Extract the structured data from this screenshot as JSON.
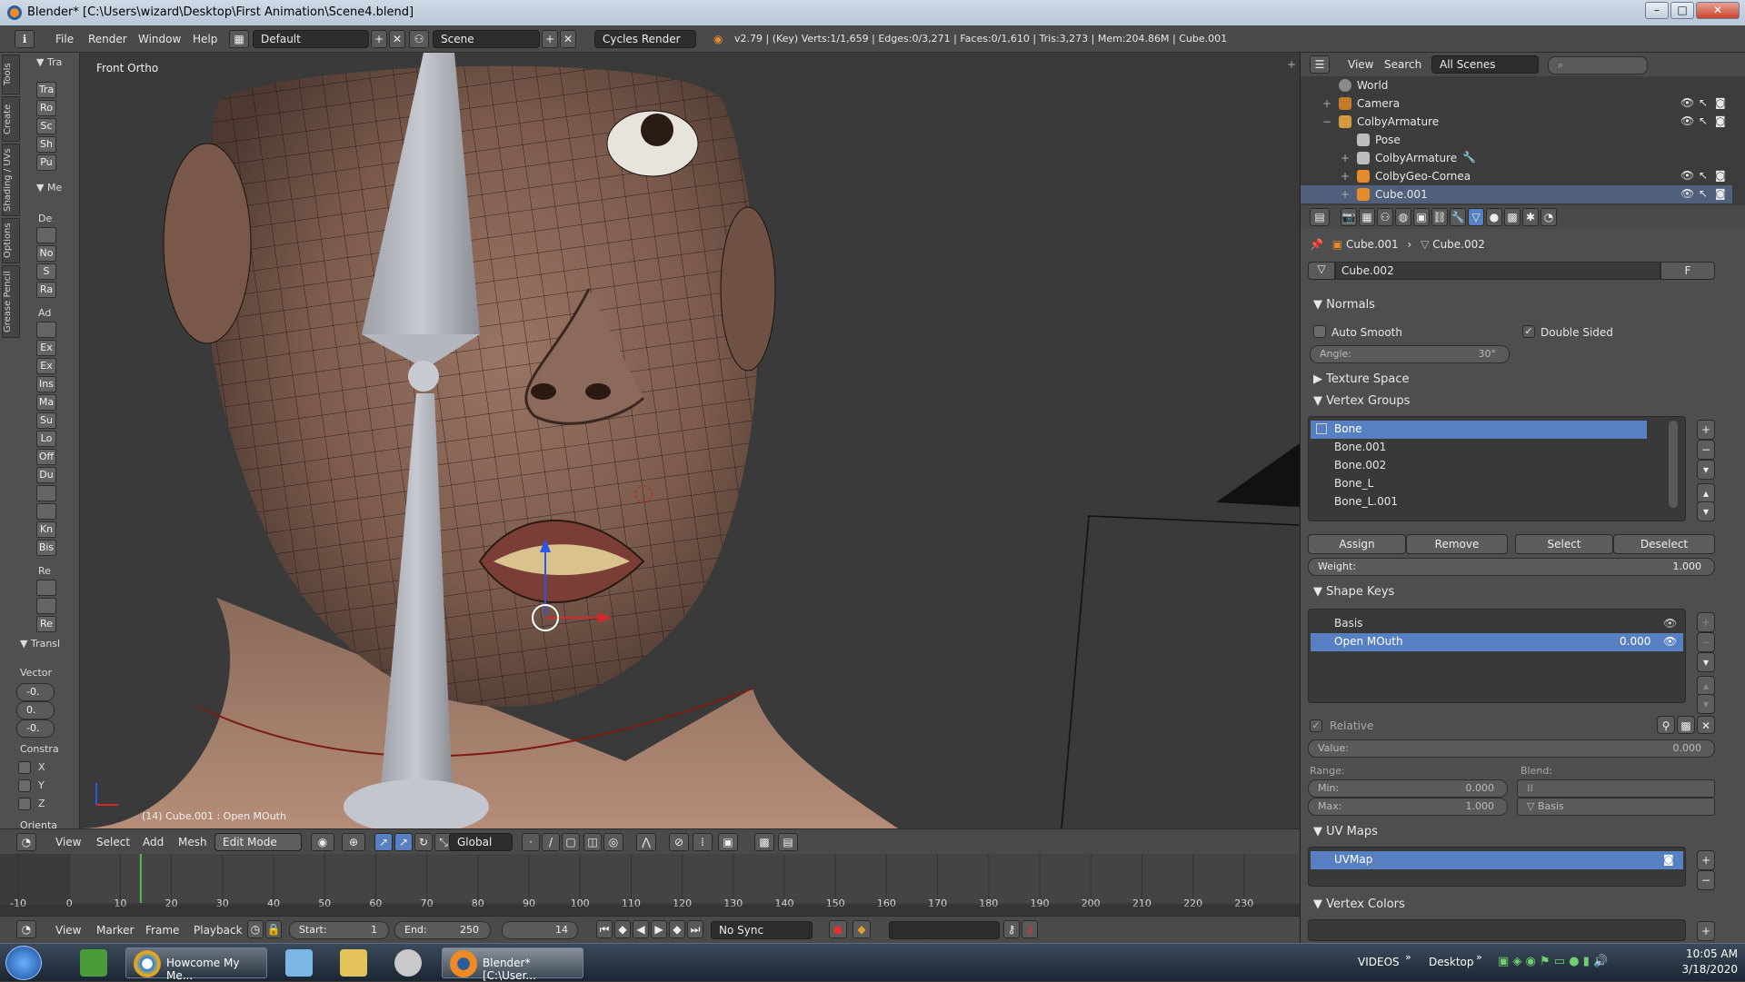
{
  "window": {
    "title": "Blender* [C:\\Users\\wizard\\Desktop\\First Animation\\Scene4.blend]",
    "min": "–",
    "max": "□",
    "close": "✕"
  },
  "menus": [
    "File",
    "Render",
    "Window",
    "Help"
  ],
  "screen_layout": "Default",
  "scene": "Scene",
  "render_engine": "Cycles Render",
  "stats": "v2.79 | (Key) Verts:1/1,659 | Edges:0/3,271 | Faces:0/1,610 | Tris:3,273 | Mem:204.86M | Cube.001",
  "toolshelf": {
    "tabs": [
      "Tools",
      "Create",
      "Shading / UVs",
      "Options",
      "Grease Pencil"
    ],
    "transform_header": "Tra",
    "transform_buttons": [
      "Tra",
      "Ro",
      "Sc",
      "Sh",
      "Pu"
    ],
    "mesh_header": "Me",
    "deform_label": "De",
    "deform_buttons": [
      "",
      "No",
      "S",
      "Ra"
    ],
    "add_label": "Ad",
    "add_buttons": [
      "",
      "Ex",
      "Ex",
      "Ins",
      "Ma",
      "Su",
      "Lo",
      "Off",
      "Du",
      "",
      "",
      "Kn",
      "Bis"
    ],
    "remove_label": "Re",
    "remove_buttons": [
      "",
      "",
      "Re"
    ],
    "translate_header": "Transl",
    "vector_label": "Vector",
    "vector": [
      "-0.",
      "0.",
      "-0."
    ],
    "constraint_label": "Constra",
    "axes": [
      "X",
      "Y",
      "Z"
    ],
    "orient_label": "Orienta"
  },
  "viewport": {
    "view_label": "Front Ortho",
    "status": "(14) Cube.001 : Open MOuth"
  },
  "viewport_header": {
    "menus": [
      "View",
      "Select",
      "Add",
      "Mesh"
    ],
    "mode": "Edit Mode",
    "orientation": "Global"
  },
  "timeline": {
    "ticks": [
      "-10",
      "0",
      "10",
      "20",
      "30",
      "40",
      "50",
      "60",
      "70",
      "80",
      "90",
      "100",
      "110",
      "120",
      "130",
      "140",
      "150",
      "160",
      "170",
      "180",
      "190",
      "200",
      "210",
      "220",
      "230"
    ],
    "current_frame_marker": 14,
    "menus": [
      "View",
      "Marker",
      "Frame",
      "Playback"
    ],
    "start_label": "Start:",
    "start": "1",
    "end_label": "End:",
    "end": "250",
    "current": "14",
    "sync": "No Sync"
  },
  "outliner": {
    "menus": [
      "View",
      "Search"
    ],
    "filter": "All Scenes",
    "items": [
      {
        "label": "World",
        "color": "#8a8a8a"
      },
      {
        "label": "Camera",
        "color": "#c47a2a"
      },
      {
        "label": "ColbyArmature",
        "color": "#d49b3c"
      },
      {
        "label": "Pose",
        "color": "#bdbdbd"
      },
      {
        "label": "ColbyArmature",
        "color": "#bdbdbd"
      },
      {
        "label": "ColbyGeo-Cornea",
        "color": "#e58b2b"
      },
      {
        "label": "Cube.001",
        "color": "#e58b2b"
      }
    ]
  },
  "properties": {
    "breadcrumb": [
      "Cube.001",
      "Cube.002"
    ],
    "mesh_name": "Cube.002",
    "fake_user": "F",
    "normals": {
      "header": "Normals",
      "auto_smooth": "Auto Smooth",
      "double_sided": "Double Sided",
      "angle_label": "Angle:",
      "angle": "30°"
    },
    "texture_space": "Texture Space",
    "vertex_groups": {
      "header": "Vertex Groups",
      "items": [
        "Bone",
        "Bone.001",
        "Bone.002",
        "Bone_L",
        "Bone_L.001"
      ],
      "assign": "Assign",
      "remove": "Remove",
      "select": "Select",
      "deselect": "Deselect",
      "weight_label": "Weight:",
      "weight": "1.000"
    },
    "shape_keys": {
      "header": "Shape Keys",
      "items": [
        {
          "label": "Basis",
          "value": ""
        },
        {
          "label": "Open MOuth",
          "value": "0.000"
        }
      ],
      "relative": "Relative",
      "value_label": "Value:",
      "value": "0.000",
      "range_label": "Range:",
      "blend_label": "Blend:",
      "min_label": "Min:",
      "min": "0.000",
      "max_label": "Max:",
      "max": "1.000",
      "basis": "Basis"
    },
    "uv_maps": {
      "header": "UV Maps",
      "items": [
        "UVMap"
      ]
    },
    "vertex_colors": {
      "header": "Vertex Colors"
    }
  },
  "taskbar": {
    "chrome_label": "Howcome My Me...",
    "blender_label": "Blender* [C:\\User...",
    "videos": "VIDEOS",
    "desktop": "Desktop",
    "time": "10:05 AM",
    "date": "3/18/2020"
  }
}
